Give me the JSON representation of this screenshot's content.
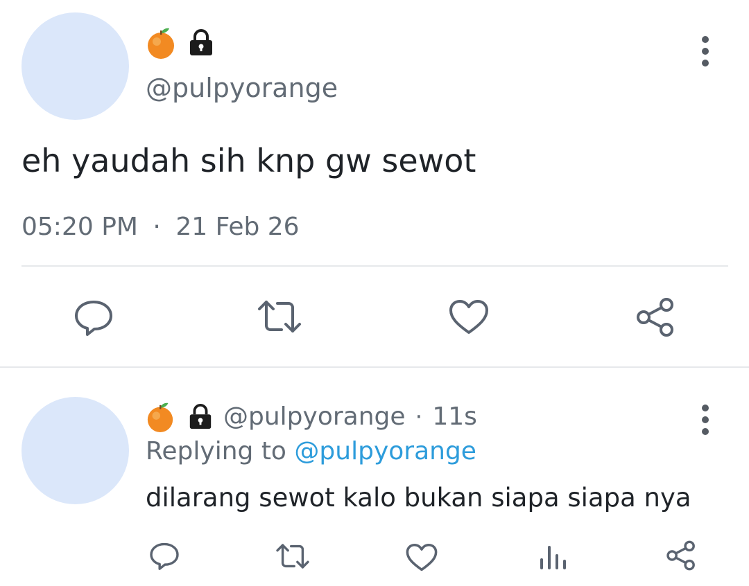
{
  "colors": {
    "avatar": "#dbe7fa",
    "text": "#1f2328",
    "muted": "#626b75",
    "link": "#2d9cdb",
    "icon": "#5a6370",
    "divider": "#e6e8eb"
  },
  "main_tweet": {
    "badges": [
      "orange-emoji",
      "lock-icon"
    ],
    "handle": "@pulpyorange",
    "text": "eh yaudah sih knp gw sewot",
    "time": "05:20 PM",
    "separator": "·",
    "date": "21 Feb 26",
    "actions": [
      "reply-icon",
      "retweet-icon",
      "like-icon",
      "share-icon"
    ]
  },
  "reply_tweet": {
    "badges": [
      "orange-emoji",
      "lock-icon"
    ],
    "handle": "@pulpyorange",
    "separator": "·",
    "age": "11s",
    "replying_prefix": "Replying to",
    "replying_handle": "@pulpyorange",
    "text": "dilarang sewot kalo bukan siapa siapa nya",
    "actions": [
      "reply-icon",
      "retweet-icon",
      "like-icon",
      "stats-icon",
      "share-icon"
    ]
  }
}
